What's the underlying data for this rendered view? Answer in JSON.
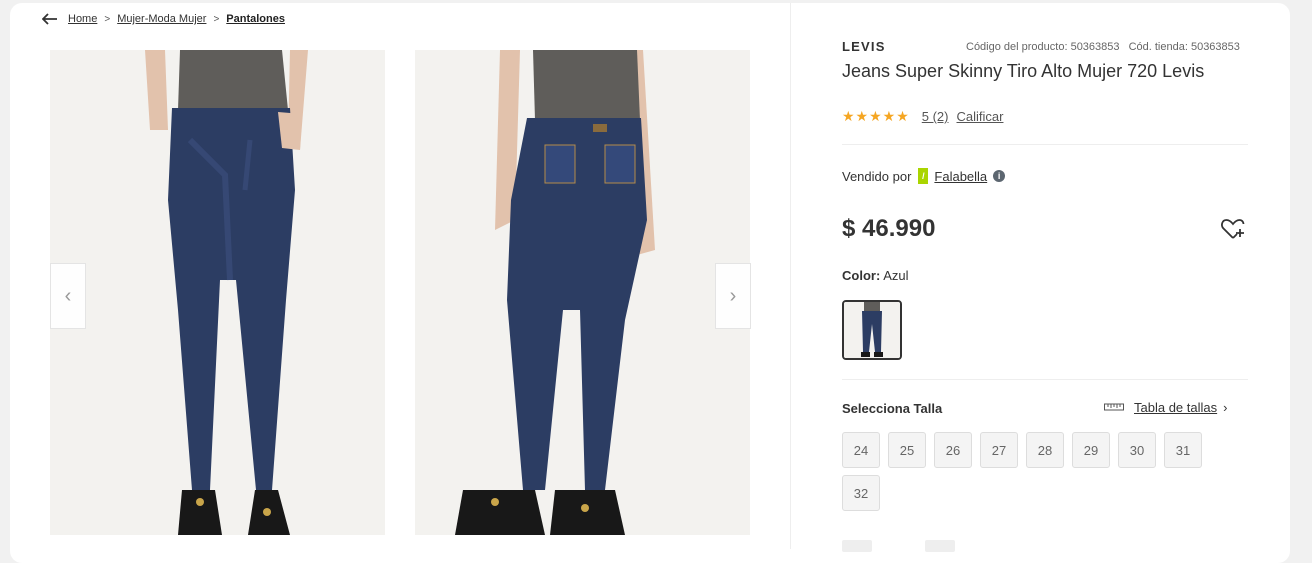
{
  "breadcrumb": {
    "items": [
      "Home",
      "Mujer-Moda Mujer",
      "Pantalones"
    ],
    "separator": ">"
  },
  "gallery": {
    "prev_icon": "chevron-left-icon",
    "next_icon": "chevron-right-icon",
    "prev_label": "‹",
    "next_label": "›"
  },
  "product": {
    "brand": "LEVIS",
    "code": "Código del producto: 50363853",
    "store_code": "Cód. tienda: 50363853",
    "title": "Jeans Super Skinny Tiro Alto Mujer 720 Levis",
    "stars": "★★★★★",
    "rating_value": 5,
    "rating_text": "5 (2)",
    "rate_link": "Calificar",
    "seller_label": "Vendido por",
    "seller_name": "Falabella",
    "seller_logo": "/",
    "info_icon": "i",
    "price": "$ 46.990",
    "color_label": "Color:",
    "color_value": "Azul",
    "size_label": "Selecciona Talla",
    "size_table_link": "Tabla de tallas",
    "size_table_chevron": "›",
    "sizes": [
      "24",
      "25",
      "26",
      "27",
      "28",
      "29",
      "30",
      "31",
      "32"
    ]
  },
  "colors": {
    "accent_star": "#f5a623",
    "seller_green": "#aad500",
    "denim": "#2c3d63",
    "top_gray": "#5f5d5a"
  }
}
